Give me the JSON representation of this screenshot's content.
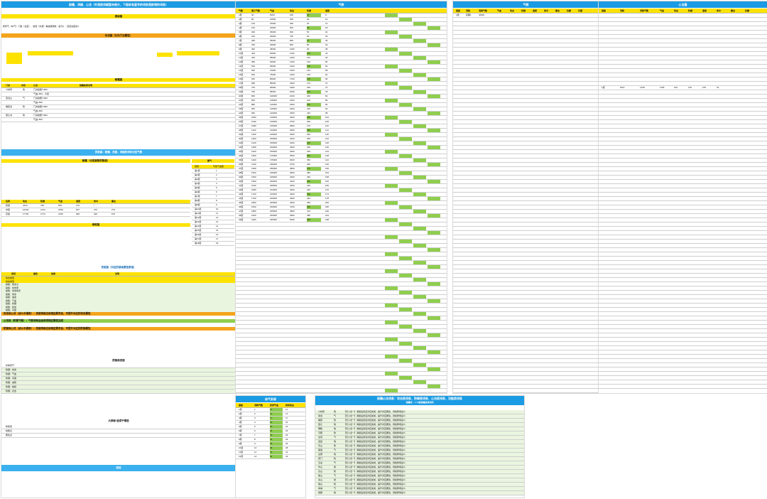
{
  "sheet1": {
    "title": "秘籍、词缀、心法（外观类词缀暂未统计，下面标有星号的词条是新增的词条）",
    "section_basic": "基础篇",
    "section_intro_line": "所有气（80气）门级（法宝）、前置（外装）等技能转换：斩元0 ... 武圣诀变化5",
    "section_clan_title": "功法篇（分为门派属性）",
    "section_secret": "秘籍篇",
    "section_transfer_title": "历练篇：秘籍、技能、词缀的词条对应气数",
    "section_learn_title": "秘籍（也是真数的数值）",
    "section_demand": "修炼篇",
    "section_combat_title": "技能篇（对应的基础属性数值）",
    "section_combat_sub": "战斗类技能",
    "section_defense_title": "防御类技能",
    "section_extra_title": "大屏秘·值得干哪些",
    "section_other": "其他",
    "clan_headers": [
      "门派",
      "内功",
      "心法",
      "秘籍效果说明"
    ],
    "clan_rows": [
      {
        "clan": "少林寺",
        "type": "攻",
        "note": "门派技能*1600"
      },
      {
        "clan": "",
        "type": "",
        "note": "气血+500，大招"
      },
      {
        "clan": "武当山",
        "type": "气",
        "note": "门派技能*1600"
      },
      {
        "clan": "",
        "type": "",
        "note": "气血+500"
      },
      {
        "clan": "峨眉派",
        "type": "防",
        "note": "门派技能*1600"
      },
      {
        "clan": "",
        "type": "",
        "note": "气血+500"
      },
      {
        "clan": "昆仑派",
        "type": "攻",
        "note": "门派技能*1600"
      },
      {
        "clan": "",
        "type": "",
        "note": "气血+500"
      }
    ],
    "stat_headers": [
      "名称",
      "攻击",
      "防御",
      "气血",
      "速度",
      "命中",
      "暴击"
    ],
    "stat_rows": [
      [
        "初级",
        "4444",
        "796",
        "509",
        "272",
        "/",
        "/"
      ],
      [
        "中级",
        "10444",
        "1444",
        "1099",
        "667",
        "270",
        "270"
      ],
      [
        "高级",
        "17700",
        "2770",
        "2159",
        "990",
        "400",
        "570"
      ]
    ],
    "right_panel_title": "属气",
    "right_panel_headers": [
      "层级",
      "可加气血数"
    ],
    "right_panel_rows": [
      "1",
      "2",
      "3",
      "4",
      "5",
      "6",
      "7",
      "8",
      "9",
      "10",
      "11",
      "12",
      "13",
      "14",
      "15",
      "16",
      "17",
      "18"
    ],
    "combat_headers": [
      "类别",
      "属性",
      "效果",
      "说明"
    ],
    "combat_rows": [
      "攻击类型",
      "攻击类型",
      "秘籍：攻击力",
      "秘籍：暴击率",
      "秘籍：暴击伤害",
      "秘籍：命中",
      "秘籍：速度",
      "秘籍：气血",
      "秘籍：防御",
      "秘籍：抗暴",
      "秘籍：闪避"
    ],
    "highlight_line_1": "攻击类心法（战斗中通用）：技能等级达到相应要求后，可提升对应的攻击属性",
    "highlight_line_2": "防御类心法（战斗中通用）：技能等级达到相应要求后，可提升对应的防御属性",
    "highlight_line_3": "心法类（积累气数）：气数消耗后会获得相应属性加成",
    "defense_rows": [
      "护体真气",
      "防御：抗暴",
      "防御：气血",
      "防御：闪避",
      "防御：减伤",
      "防御：格挡",
      "防御：反击"
    ],
    "extra_rows": [
      "修炼值",
      "技能点",
      "属性点"
    ]
  },
  "sheet2": {
    "title": "气数",
    "headers": [
      "气数",
      "累计气数",
      "气血",
      "攻击",
      "防御",
      "速度"
    ],
    "rows": [
      [
        "1层",
        "40",
        "5000",
        "200",
        "10",
        "6"
      ],
      [
        "2层",
        "80",
        "10000",
        "300",
        "20",
        "10"
      ],
      [
        "3层",
        "120",
        "15000",
        "400",
        "30",
        "14"
      ],
      [
        "4层",
        "160",
        "20000",
        "500",
        "40",
        "18"
      ],
      [
        "5层",
        "200",
        "25000",
        "600",
        "50",
        "22"
      ],
      [
        "6层",
        "240",
        "30000",
        "700",
        "60",
        "26"
      ],
      [
        "7层",
        "280",
        "35000",
        "800",
        "70",
        "30"
      ],
      [
        "8层",
        "320",
        "40000",
        "900",
        "80",
        "34"
      ],
      [
        "9层",
        "360",
        "45000",
        "1000",
        "90",
        "38"
      ],
      [
        "10层",
        "400",
        "50000",
        "1100",
        "100",
        "42"
      ],
      [
        "11层",
        "440",
        "55000",
        "1200",
        "110",
        "46"
      ],
      [
        "12层",
        "480",
        "60000",
        "1300",
        "120",
        "50"
      ],
      [
        "13层",
        "520",
        "65000",
        "1400",
        "130",
        "54"
      ],
      [
        "14层",
        "560",
        "70000",
        "1500",
        "140",
        "58"
      ],
      [
        "15层",
        "600",
        "75000",
        "1600",
        "150",
        "62"
      ],
      [
        "16层",
        "640",
        "80000",
        "1700",
        "160",
        "66"
      ],
      [
        "17层",
        "680",
        "85000",
        "1800",
        "170",
        "70"
      ],
      [
        "18层",
        "720",
        "90000",
        "1900",
        "180",
        "74"
      ],
      [
        "19层",
        "760",
        "95000",
        "2000",
        "190",
        "78"
      ],
      [
        "20层",
        "800",
        "100000",
        "2100",
        "200",
        "82"
      ],
      [
        "21层",
        "840",
        "105000",
        "2200",
        "210",
        "86"
      ],
      [
        "22层",
        "880",
        "110000",
        "2300",
        "220",
        "90"
      ],
      [
        "23层",
        "920",
        "115000",
        "2400",
        "230",
        "94"
      ],
      [
        "24层",
        "960",
        "120000",
        "2500",
        "240",
        "98"
      ],
      [
        "25层",
        "1000",
        "125000",
        "2600",
        "250",
        "102"
      ],
      [
        "26层",
        "1040",
        "130000",
        "2700",
        "260",
        "106"
      ],
      [
        "27层",
        "1080",
        "135000",
        "2800",
        "270",
        "110"
      ],
      [
        "28层",
        "1120",
        "140000",
        "2900",
        "280",
        "114"
      ],
      [
        "29层",
        "1160",
        "145000",
        "3000",
        "290",
        "118"
      ],
      [
        "30层",
        "1200",
        "150000",
        "3100",
        "300",
        "122"
      ],
      [
        "31层",
        "1240",
        "155000",
        "3200",
        "310",
        "126"
      ],
      [
        "32层",
        "1280",
        "160000",
        "3300",
        "320",
        "130"
      ],
      [
        "33层",
        "1320",
        "165000",
        "3400",
        "330",
        "134"
      ],
      [
        "34层",
        "1360",
        "170000",
        "3500",
        "340",
        "138"
      ],
      [
        "35层",
        "1400",
        "175000",
        "3600",
        "350",
        "142"
      ],
      [
        "36层",
        "1440",
        "180000",
        "3700",
        "360",
        "146"
      ],
      [
        "37层",
        "1480",
        "185000",
        "3800",
        "370",
        "150"
      ],
      [
        "38层",
        "1520",
        "190000",
        "3900",
        "380",
        "154"
      ],
      [
        "39层",
        "1560",
        "195000",
        "4000",
        "390",
        "158"
      ],
      [
        "40层",
        "1600",
        "200000",
        "4100",
        "400",
        "162"
      ],
      [
        "41层",
        "1640",
        "205000",
        "4200",
        "410",
        "166"
      ],
      [
        "42层",
        "1680",
        "210000",
        "4300",
        "420",
        "170"
      ],
      [
        "43层",
        "1720",
        "215000",
        "4400",
        "430",
        "174"
      ],
      [
        "44层",
        "1760",
        "220000",
        "4500",
        "440",
        "178"
      ],
      [
        "45层",
        "1800",
        "225000",
        "4600",
        "450",
        "182"
      ],
      [
        "46层",
        "1840",
        "230000",
        "4700",
        "460",
        "186"
      ],
      [
        "47层",
        "1880",
        "235000",
        "4800",
        "470",
        "190"
      ],
      [
        "48层",
        "1920",
        "240000",
        "4900",
        "480",
        "194"
      ],
      [
        "49层",
        "1960",
        "245000",
        "5000",
        "490",
        "198"
      ]
    ]
  },
  "sheet2b": {
    "title": "修气系统",
    "headers": [
      "层级",
      "消耗气数",
      "获得气血",
      "获得攻击"
    ],
    "rows": [
      [
        "1层",
        "1",
        "11",
        "11"
      ],
      [
        "2层",
        "2",
        "14",
        "14"
      ],
      [
        "3层",
        "3",
        "17",
        "17"
      ],
      [
        "4层",
        "4",
        "20",
        "20"
      ],
      [
        "5层",
        "5",
        "23",
        "23"
      ],
      [
        "6层",
        "6",
        "26",
        "26"
      ],
      [
        "7层",
        "7",
        "29",
        "29"
      ],
      [
        "8层",
        "8",
        "32",
        "32"
      ],
      [
        "9层",
        "9",
        "35",
        "35"
      ],
      [
        "10层",
        "10",
        "38",
        "38"
      ],
      [
        "11层",
        "11",
        "41",
        "41"
      ],
      [
        "12层",
        "12",
        "44",
        "44"
      ]
    ]
  },
  "sheet3": {
    "title": "气数",
    "headers": [
      "层级",
      "消耗",
      "消耗气数",
      "气血",
      "攻击",
      "防御",
      "速度",
      "命中",
      "暴击",
      "抗暴",
      "闪避"
    ],
    "highlight_row": [
      "1层",
      "初期1",
      "40000"
    ]
  },
  "sheet3b": {
    "title": "秘籍心法词条：攻击类词条、防御类词条、心法类词条、功能类词条",
    "subtitle": "秘籍类：1-10层秘籍效果说明",
    "rows": [
      {
        "label": "少林寺",
        "tag": "攻"
      },
      {
        "label": "武当",
        "tag": "气"
      },
      {
        "label": "峨眉",
        "tag": "防"
      },
      {
        "label": "昆仑",
        "tag": "攻"
      },
      {
        "label": "明教",
        "tag": "攻"
      },
      {
        "label": "丐帮",
        "tag": "防"
      },
      {
        "label": "全真",
        "tag": "气"
      },
      {
        "label": "逍遥",
        "tag": "攻"
      },
      {
        "label": "天山",
        "tag": "防"
      },
      {
        "label": "星宿",
        "tag": "气"
      },
      {
        "label": "古墓",
        "tag": "攻"
      },
      {
        "label": "唐门",
        "tag": "防"
      },
      {
        "label": "五毒",
        "tag": "气"
      },
      {
        "label": "华山",
        "tag": "攻"
      },
      {
        "label": "嵩山",
        "tag": "防"
      },
      {
        "label": "衡山",
        "tag": "气"
      },
      {
        "label": "泰山",
        "tag": "攻"
      },
      {
        "label": "恒山",
        "tag": "防"
      },
      {
        "label": "青城",
        "tag": "气"
      },
      {
        "label": "崆峒",
        "tag": "攻"
      }
    ],
    "desc": "【天人合一】满级后激活对应加成，提升对应属性，持续整场战斗"
  },
  "sheet4": {
    "title": "心法篇",
    "headers": [
      "层级",
      "消耗",
      "消耗气数",
      "气血",
      "攻击",
      "防御",
      "速度",
      "命中",
      "暴击",
      "抗暴"
    ],
    "highlight_row": [
      "1层",
      "MAX",
      "1228",
      "1195",
      "100",
      "118",
      "105",
      "32"
    ]
  },
  "colors": {
    "header_blue": "#1b9be3",
    "yellow": "#fde200",
    "orange": "#f4a41c",
    "green": "#8fce4e"
  }
}
